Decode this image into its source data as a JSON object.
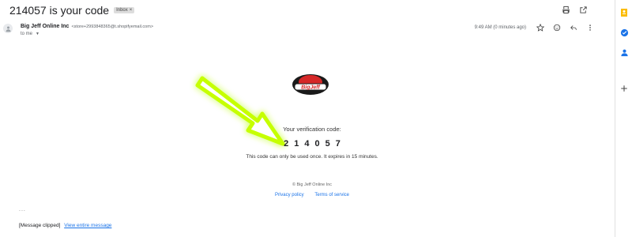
{
  "subject": "214057 is your code",
  "badge": {
    "label": "Inbox",
    "close": "×"
  },
  "sender": {
    "name": "Big Jeff Online Inc",
    "email": "<store+2993848365@t.shopifyemail.com>"
  },
  "recipient_line": "to me",
  "timestamp": "9:49 AM (0 minutes ago)",
  "icons": {
    "top": [
      "printer-icon",
      "open-in-new-window-icon"
    ],
    "meta": [
      "star-icon",
      "emoji-react-icon",
      "reply-icon",
      "more-options-icon"
    ],
    "rail": [
      "keep-icon",
      "tasks-icon",
      "contacts-icon",
      "add-icon"
    ]
  },
  "logo_text": "BigJeff",
  "body": {
    "verification_label": "Your verification code:",
    "code": "214057",
    "note": "This code can only be used once. It expires in 15 minutes.",
    "copyright": "© Big Jeff Online Inc",
    "privacy_link": "Privacy policy",
    "terms_link": "Terms of service",
    "ellipsis": "...",
    "clipped_label": "[Message clipped]",
    "view_entire": "View entire message"
  },
  "colors": {
    "link": "#1a73e8",
    "arrow_glow": "#c6ff00",
    "keep_yellow": "#fbbc04",
    "tasks_blue": "#1a73e8",
    "logo_red": "#d62828"
  }
}
